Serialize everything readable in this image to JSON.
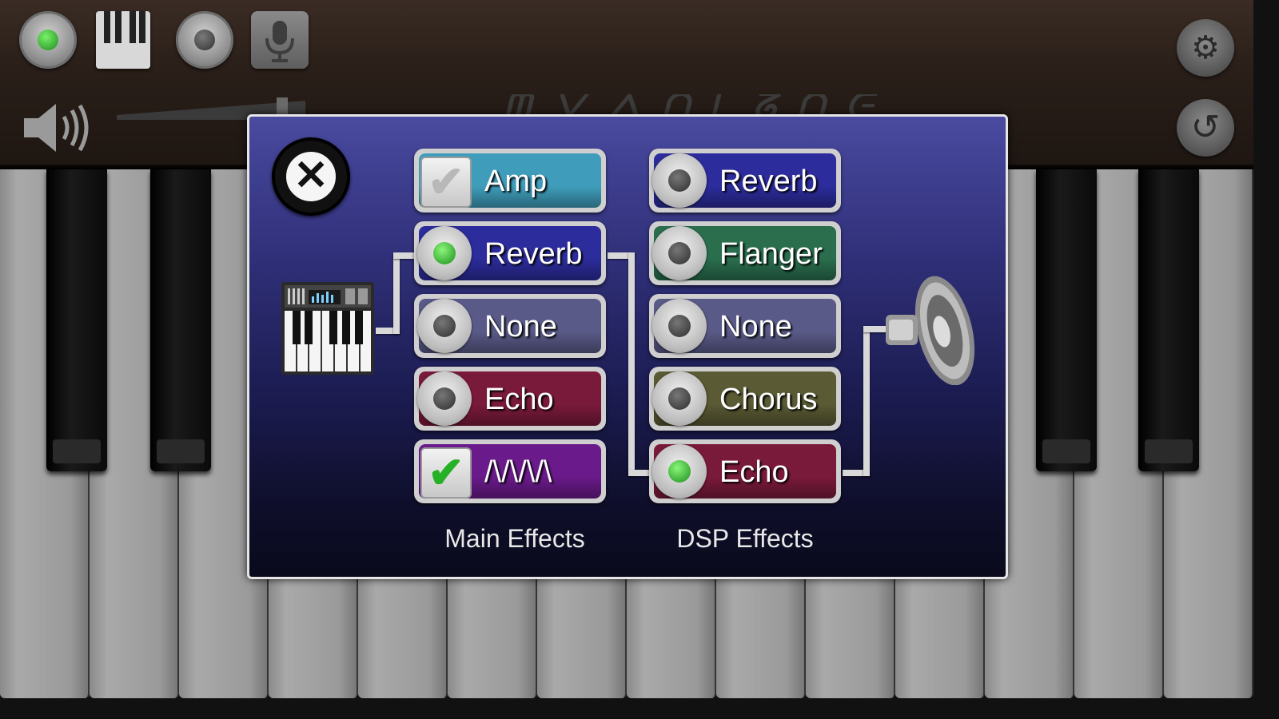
{
  "toolbar": {
    "record_dot_color": "#3ab73a",
    "icons": [
      "record-icon",
      "piano-keys-icon",
      "stop-icon",
      "microphone-icon",
      "gear-icon",
      "undo-icon",
      "speaker-icon"
    ]
  },
  "dialog": {
    "main_effects_label": "Main Effects",
    "dsp_effects_label": "DSP Effects",
    "main_effects": [
      {
        "label": "Amp",
        "control": "checkbox",
        "checked": false,
        "color": "#3f9dbb"
      },
      {
        "label": "Reverb",
        "control": "radio",
        "checked": true,
        "color": "#2c2c9c"
      },
      {
        "label": "None",
        "control": "radio",
        "checked": false,
        "color": "#5a5a88"
      },
      {
        "label": "Echo",
        "control": "radio",
        "checked": false,
        "color": "#7a1a3a"
      },
      {
        "label": "/\\/\\/\\/\\",
        "control": "checkbox",
        "checked": true,
        "color": "#6a1a8a"
      }
    ],
    "dsp_effects": [
      {
        "label": "Reverb",
        "control": "radio",
        "checked": false,
        "color": "#2c2c9c"
      },
      {
        "label": "Flanger",
        "control": "radio",
        "checked": false,
        "color": "#2a6e4e"
      },
      {
        "label": "None",
        "control": "radio",
        "checked": false,
        "color": "#5a5a88"
      },
      {
        "label": "Chorus",
        "control": "radio",
        "checked": false,
        "color": "#5a5a34"
      },
      {
        "label": "Echo",
        "control": "radio",
        "checked": true,
        "color": "#7a1a3a"
      }
    ]
  }
}
